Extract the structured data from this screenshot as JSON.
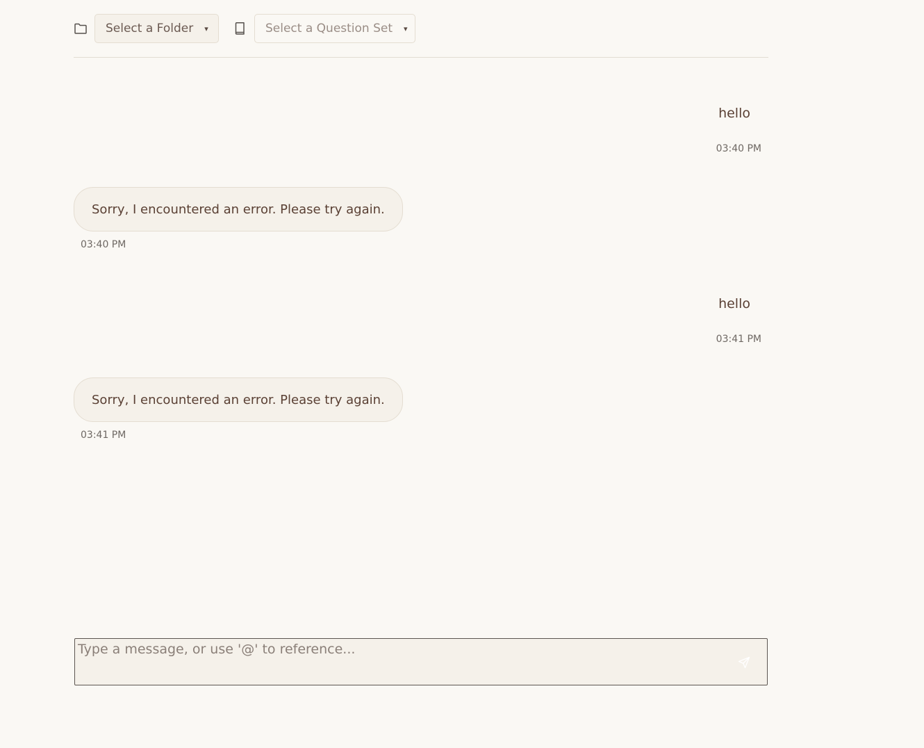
{
  "toolbar": {
    "folder_icon": "folder-icon",
    "folder_select_label": "Select a Folder",
    "book_icon": "book-icon",
    "question_set_select_label": "Select a Question Set",
    "caret_glyph": "▾"
  },
  "messages": [
    {
      "role": "user",
      "text": "hello",
      "time": "03:40 PM"
    },
    {
      "role": "assistant",
      "text": "Sorry, I encountered an error. Please try again.",
      "time": "03:40 PM"
    },
    {
      "role": "user",
      "text": "hello",
      "time": "03:41 PM"
    },
    {
      "role": "assistant",
      "text": "Sorry, I encountered an error. Please try again.",
      "time": "03:41 PM"
    }
  ],
  "composer": {
    "placeholder": "Type a message, or use '@' to reference...",
    "value": "",
    "send_icon": "send-icon"
  },
  "colors": {
    "background": "#faf8f4",
    "bubble": "#f5f1ea",
    "text": "#5a4034",
    "muted": "#6e6863"
  }
}
